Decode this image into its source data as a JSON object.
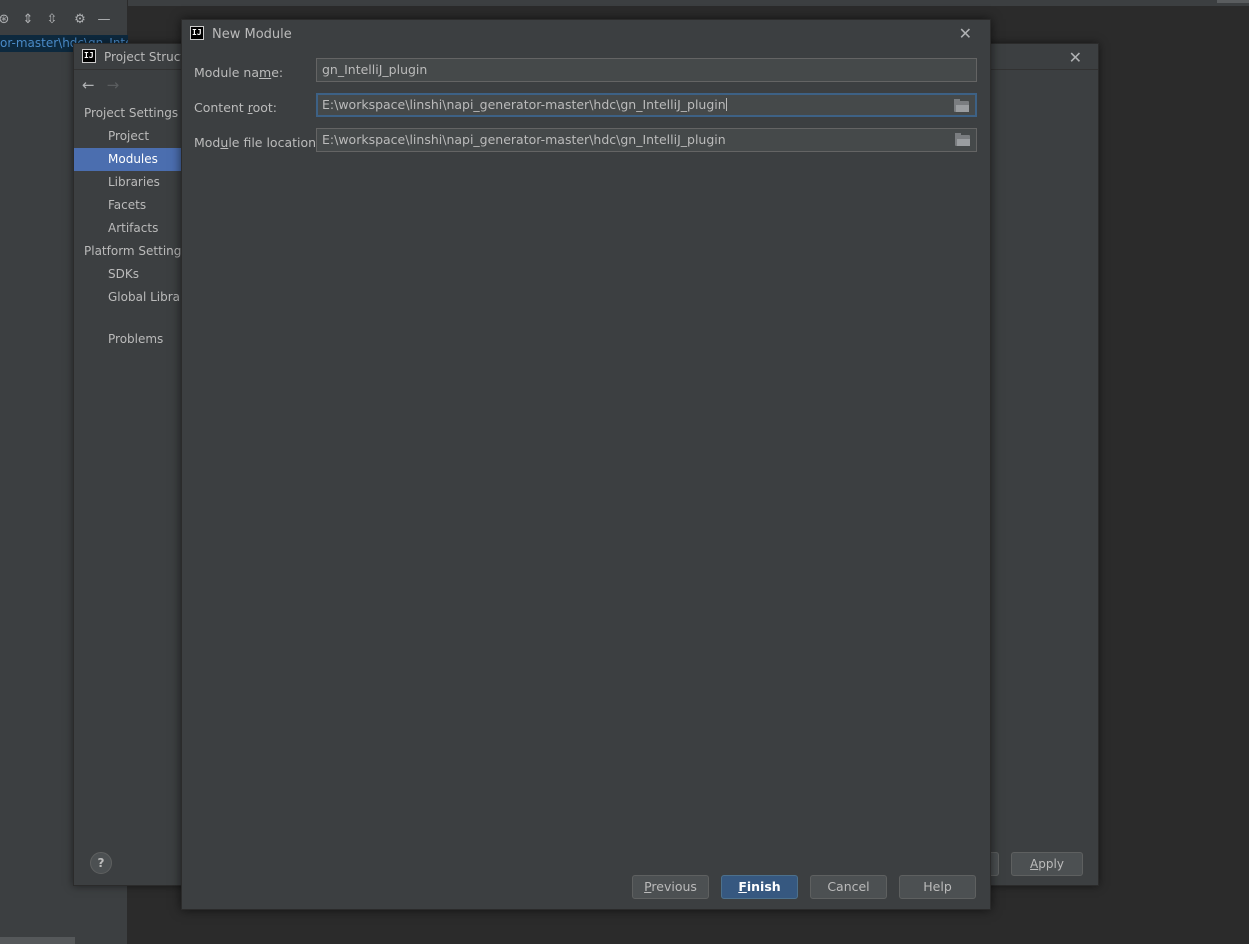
{
  "ide": {
    "selected_path": "or-master\\hdc\\gn_Inte",
    "toolbar_icons": [
      "locate-icon",
      "expand-all-icon",
      "collapse-all-icon",
      "gear-icon",
      "minimize-icon"
    ]
  },
  "project_structure": {
    "title": "Project Structure",
    "sidebar": {
      "project_settings_label": "Project Settings",
      "items_top": [
        {
          "label": "Project"
        },
        {
          "label": "Modules",
          "selected": true
        },
        {
          "label": "Libraries"
        },
        {
          "label": "Facets"
        },
        {
          "label": "Artifacts"
        }
      ],
      "platform_settings_label": "Platform Settings",
      "items_platform": [
        {
          "label": "SDKs"
        },
        {
          "label": "Global Libraries"
        }
      ],
      "problems_label": "Problems"
    },
    "help_label": "?",
    "apply_label": "Apply"
  },
  "new_module": {
    "title": "New Module",
    "fields": {
      "module_name": {
        "label": "Module name:",
        "value": "gn_IntelliJ_plugin"
      },
      "content_root": {
        "label": "Content root:",
        "value": "E:\\workspace\\linshi\\napi_generator-master\\hdc\\gn_IntelliJ_plugin"
      },
      "module_file_location": {
        "label": "Module file location:",
        "value": "E:\\workspace\\linshi\\napi_generator-master\\hdc\\gn_IntelliJ_plugin"
      }
    },
    "buttons": {
      "previous": "Previous",
      "finish": "Finish",
      "cancel": "Cancel",
      "help": "Help"
    },
    "colors": {
      "accent": "#365880",
      "selection": "#4b6eaf",
      "dialog_bg": "#3c3f41"
    }
  }
}
